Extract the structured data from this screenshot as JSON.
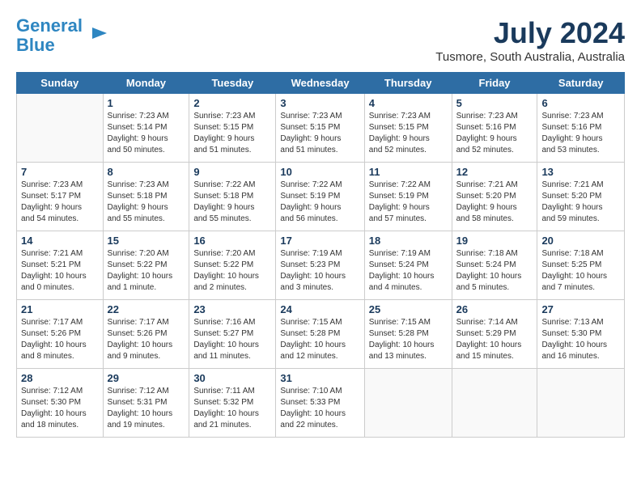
{
  "header": {
    "logo_line1": "General",
    "logo_line2": "Blue",
    "month": "July 2024",
    "location": "Tusmore, South Australia, Australia"
  },
  "weekdays": [
    "Sunday",
    "Monday",
    "Tuesday",
    "Wednesday",
    "Thursday",
    "Friday",
    "Saturday"
  ],
  "weeks": [
    [
      {
        "day": "",
        "content": ""
      },
      {
        "day": "1",
        "content": "Sunrise: 7:23 AM\nSunset: 5:14 PM\nDaylight: 9 hours\nand 50 minutes."
      },
      {
        "day": "2",
        "content": "Sunrise: 7:23 AM\nSunset: 5:15 PM\nDaylight: 9 hours\nand 51 minutes."
      },
      {
        "day": "3",
        "content": "Sunrise: 7:23 AM\nSunset: 5:15 PM\nDaylight: 9 hours\nand 51 minutes."
      },
      {
        "day": "4",
        "content": "Sunrise: 7:23 AM\nSunset: 5:15 PM\nDaylight: 9 hours\nand 52 minutes."
      },
      {
        "day": "5",
        "content": "Sunrise: 7:23 AM\nSunset: 5:16 PM\nDaylight: 9 hours\nand 52 minutes."
      },
      {
        "day": "6",
        "content": "Sunrise: 7:23 AM\nSunset: 5:16 PM\nDaylight: 9 hours\nand 53 minutes."
      }
    ],
    [
      {
        "day": "7",
        "content": "Sunrise: 7:23 AM\nSunset: 5:17 PM\nDaylight: 9 hours\nand 54 minutes."
      },
      {
        "day": "8",
        "content": "Sunrise: 7:23 AM\nSunset: 5:18 PM\nDaylight: 9 hours\nand 55 minutes."
      },
      {
        "day": "9",
        "content": "Sunrise: 7:22 AM\nSunset: 5:18 PM\nDaylight: 9 hours\nand 55 minutes."
      },
      {
        "day": "10",
        "content": "Sunrise: 7:22 AM\nSunset: 5:19 PM\nDaylight: 9 hours\nand 56 minutes."
      },
      {
        "day": "11",
        "content": "Sunrise: 7:22 AM\nSunset: 5:19 PM\nDaylight: 9 hours\nand 57 minutes."
      },
      {
        "day": "12",
        "content": "Sunrise: 7:21 AM\nSunset: 5:20 PM\nDaylight: 9 hours\nand 58 minutes."
      },
      {
        "day": "13",
        "content": "Sunrise: 7:21 AM\nSunset: 5:20 PM\nDaylight: 9 hours\nand 59 minutes."
      }
    ],
    [
      {
        "day": "14",
        "content": "Sunrise: 7:21 AM\nSunset: 5:21 PM\nDaylight: 10 hours\nand 0 minutes."
      },
      {
        "day": "15",
        "content": "Sunrise: 7:20 AM\nSunset: 5:22 PM\nDaylight: 10 hours\nand 1 minute."
      },
      {
        "day": "16",
        "content": "Sunrise: 7:20 AM\nSunset: 5:22 PM\nDaylight: 10 hours\nand 2 minutes."
      },
      {
        "day": "17",
        "content": "Sunrise: 7:19 AM\nSunset: 5:23 PM\nDaylight: 10 hours\nand 3 minutes."
      },
      {
        "day": "18",
        "content": "Sunrise: 7:19 AM\nSunset: 5:24 PM\nDaylight: 10 hours\nand 4 minutes."
      },
      {
        "day": "19",
        "content": "Sunrise: 7:18 AM\nSunset: 5:24 PM\nDaylight: 10 hours\nand 5 minutes."
      },
      {
        "day": "20",
        "content": "Sunrise: 7:18 AM\nSunset: 5:25 PM\nDaylight: 10 hours\nand 7 minutes."
      }
    ],
    [
      {
        "day": "21",
        "content": "Sunrise: 7:17 AM\nSunset: 5:26 PM\nDaylight: 10 hours\nand 8 minutes."
      },
      {
        "day": "22",
        "content": "Sunrise: 7:17 AM\nSunset: 5:26 PM\nDaylight: 10 hours\nand 9 minutes."
      },
      {
        "day": "23",
        "content": "Sunrise: 7:16 AM\nSunset: 5:27 PM\nDaylight: 10 hours\nand 11 minutes."
      },
      {
        "day": "24",
        "content": "Sunrise: 7:15 AM\nSunset: 5:28 PM\nDaylight: 10 hours\nand 12 minutes."
      },
      {
        "day": "25",
        "content": "Sunrise: 7:15 AM\nSunset: 5:28 PM\nDaylight: 10 hours\nand 13 minutes."
      },
      {
        "day": "26",
        "content": "Sunrise: 7:14 AM\nSunset: 5:29 PM\nDaylight: 10 hours\nand 15 minutes."
      },
      {
        "day": "27",
        "content": "Sunrise: 7:13 AM\nSunset: 5:30 PM\nDaylight: 10 hours\nand 16 minutes."
      }
    ],
    [
      {
        "day": "28",
        "content": "Sunrise: 7:12 AM\nSunset: 5:30 PM\nDaylight: 10 hours\nand 18 minutes."
      },
      {
        "day": "29",
        "content": "Sunrise: 7:12 AM\nSunset: 5:31 PM\nDaylight: 10 hours\nand 19 minutes."
      },
      {
        "day": "30",
        "content": "Sunrise: 7:11 AM\nSunset: 5:32 PM\nDaylight: 10 hours\nand 21 minutes."
      },
      {
        "day": "31",
        "content": "Sunrise: 7:10 AM\nSunset: 5:33 PM\nDaylight: 10 hours\nand 22 minutes."
      },
      {
        "day": "",
        "content": ""
      },
      {
        "day": "",
        "content": ""
      },
      {
        "day": "",
        "content": ""
      }
    ]
  ]
}
